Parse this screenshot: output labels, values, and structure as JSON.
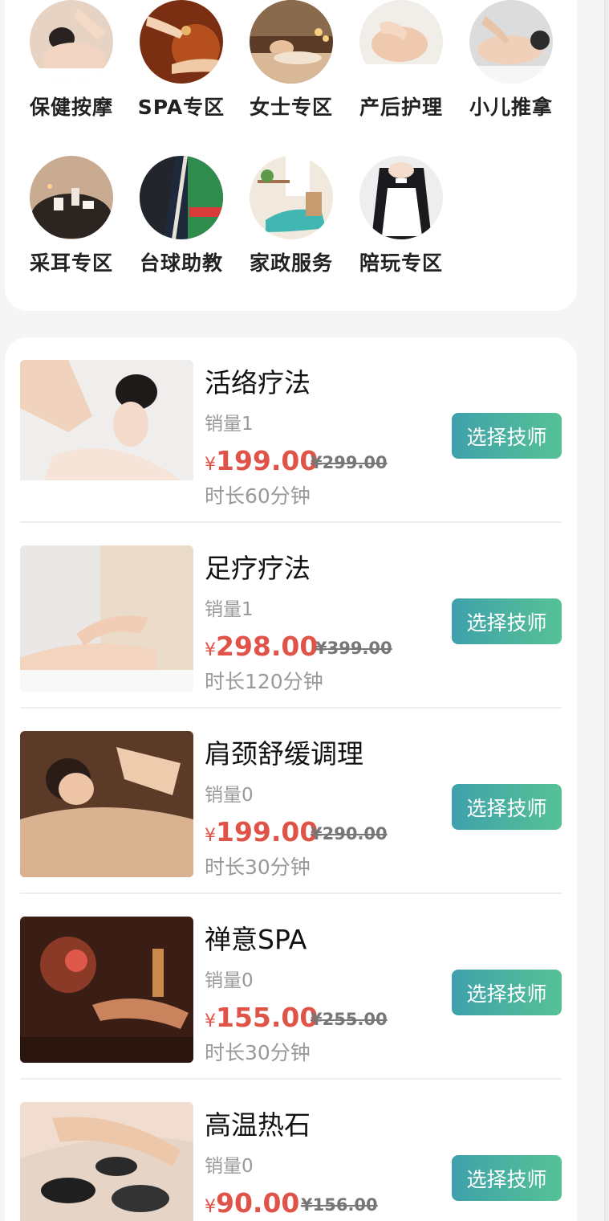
{
  "categories": [
    {
      "label": "保健按摩",
      "icon": "massage-photo"
    },
    {
      "label": "SPA专区",
      "icon": "spa-photo"
    },
    {
      "label": "女士专区",
      "icon": "womens-photo"
    },
    {
      "label": "产后护理",
      "icon": "postpartum-photo"
    },
    {
      "label": "小儿推拿",
      "icon": "kids-massage-photo"
    },
    {
      "label": "采耳专区",
      "icon": "ear-cleaning-photo"
    },
    {
      "label": "台球助教",
      "icon": "billiards-photo"
    },
    {
      "label": "家政服务",
      "icon": "housekeeping-photo"
    },
    {
      "label": "陪玩专区",
      "icon": "companion-photo"
    }
  ],
  "services": [
    {
      "name": "活络疗法",
      "sales": "销量1",
      "currency": "¥",
      "price": "199.00",
      "original_price": "¥299.00",
      "duration": "时长60分钟",
      "button": "选择技师"
    },
    {
      "name": "足疗疗法",
      "sales": "销量1",
      "currency": "¥",
      "price": "298.00",
      "original_price": "¥399.00",
      "duration": "时长120分钟",
      "button": "选择技师"
    },
    {
      "name": "肩颈舒缓调理",
      "sales": "销量0",
      "currency": "¥",
      "price": "199.00",
      "original_price": "¥290.00",
      "duration": "时长30分钟",
      "button": "选择技师"
    },
    {
      "name": "禅意SPA",
      "sales": "销量0",
      "currency": "¥",
      "price": "155.00",
      "original_price": "¥255.00",
      "duration": "时长30分钟",
      "button": "选择技师"
    },
    {
      "name": "高温热石",
      "sales": "销量0",
      "currency": "¥",
      "price": "90.00",
      "original_price": "¥156.00",
      "duration": "",
      "button": "选择技师"
    }
  ],
  "colors": {
    "price": "#e05348",
    "button_start": "#3fa1ac",
    "button_end": "#56c294"
  }
}
